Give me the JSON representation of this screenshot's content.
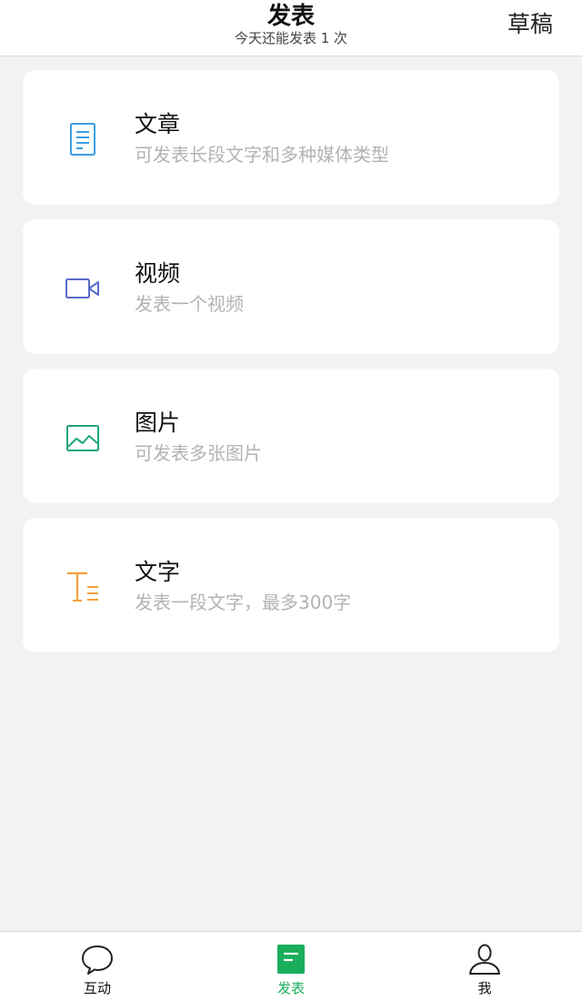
{
  "header": {
    "title": "发表",
    "subtitle": "今天还能发表 1 次",
    "drafts_label": "草稿"
  },
  "cards": [
    {
      "title": "文章",
      "description": "可发表长段文字和多种媒体类型",
      "icon": "article-icon",
      "color": "#3a9ee3"
    },
    {
      "title": "视频",
      "description": "发表一个视频",
      "icon": "video-camera-icon",
      "color": "#5b6bc9"
    },
    {
      "title": "图片",
      "description": "可发表多张图片",
      "icon": "image-icon",
      "color": "#21a57a"
    },
    {
      "title": "文字",
      "description": "发表一段文字，最多300字",
      "icon": "text-icon",
      "color": "#f3a23c"
    }
  ],
  "bottom_nav": {
    "items": [
      {
        "label": "互动",
        "icon": "chat-bubble-icon",
        "active": false
      },
      {
        "label": "发表",
        "icon": "publish-icon",
        "active": true
      },
      {
        "label": "我",
        "icon": "person-icon",
        "active": false
      }
    ],
    "active_color": "#1aad5c"
  }
}
